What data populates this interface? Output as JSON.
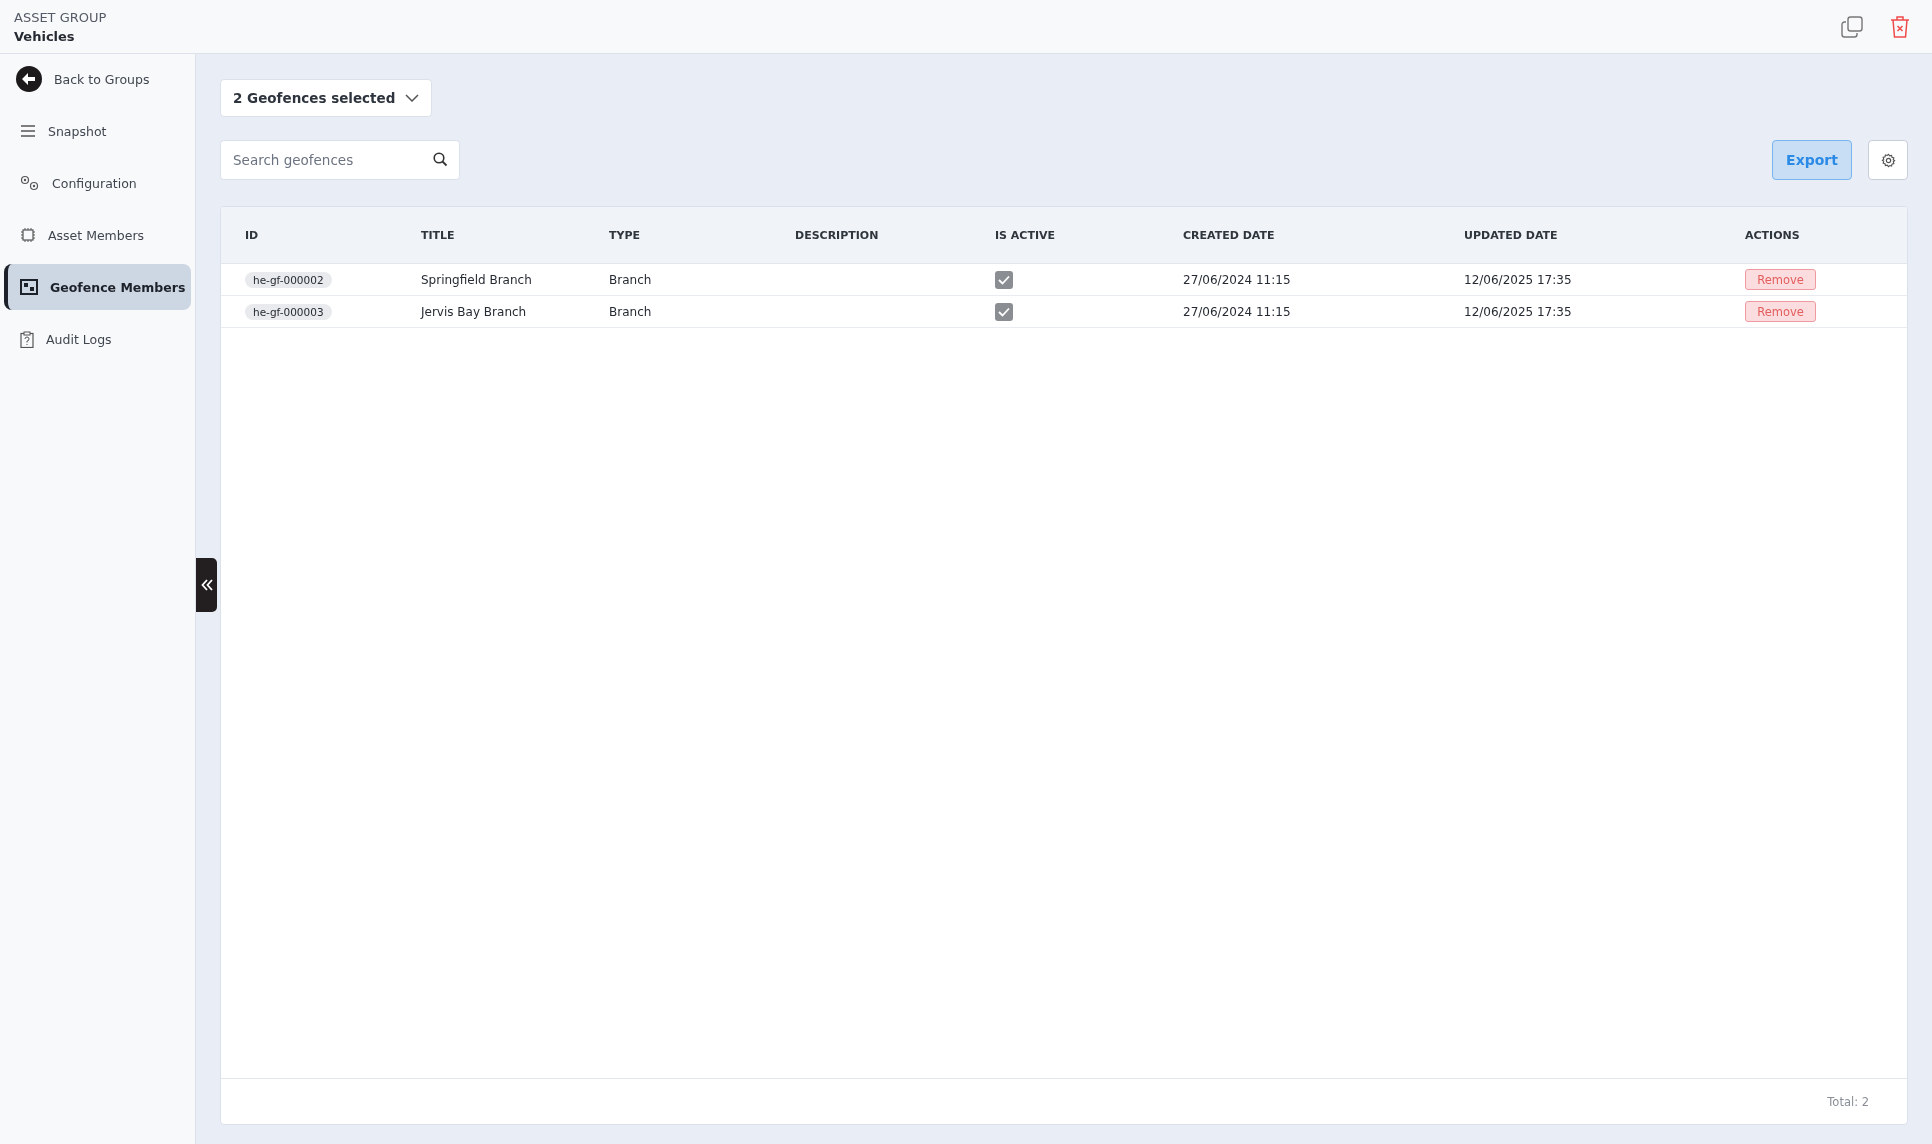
{
  "header": {
    "overline": "ASSET GROUP",
    "title": "Vehicles"
  },
  "sidebar": {
    "back": "Back to Groups",
    "items": [
      {
        "kind": "list",
        "label": "Snapshot",
        "selected": false
      },
      {
        "kind": "gears",
        "label": "Configuration",
        "selected": false
      },
      {
        "kind": "chip",
        "label": "Asset Members",
        "selected": false
      },
      {
        "kind": "fence",
        "label": "Geofence Members",
        "selected": true
      },
      {
        "kind": "clipboard",
        "label": "Audit Logs",
        "selected": false
      }
    ]
  },
  "selector": {
    "label": "2 Geofences selected"
  },
  "search": {
    "placeholder": "Search geofences"
  },
  "export_button": "Export",
  "table": {
    "columns": [
      "ID",
      "TITLE",
      "TYPE",
      "DESCRIPTION",
      "IS ACTIVE",
      "CREATED DATE",
      "UPDATED DATE",
      "ACTIONS"
    ],
    "rows": [
      {
        "id": "he-gf-000002",
        "title": "Springfield Branch",
        "type": "Branch",
        "active": true,
        "created": "27/06/2024 11:15",
        "updated": "12/06/2025 17:35",
        "action": "Remove"
      },
      {
        "id": "he-gf-000003",
        "title": "Jervis Bay Branch",
        "type": "Branch",
        "active": true,
        "created": "27/06/2024 11:15",
        "updated": "12/06/2025 17:35",
        "action": "Remove"
      }
    ],
    "total": "Total: 2"
  }
}
